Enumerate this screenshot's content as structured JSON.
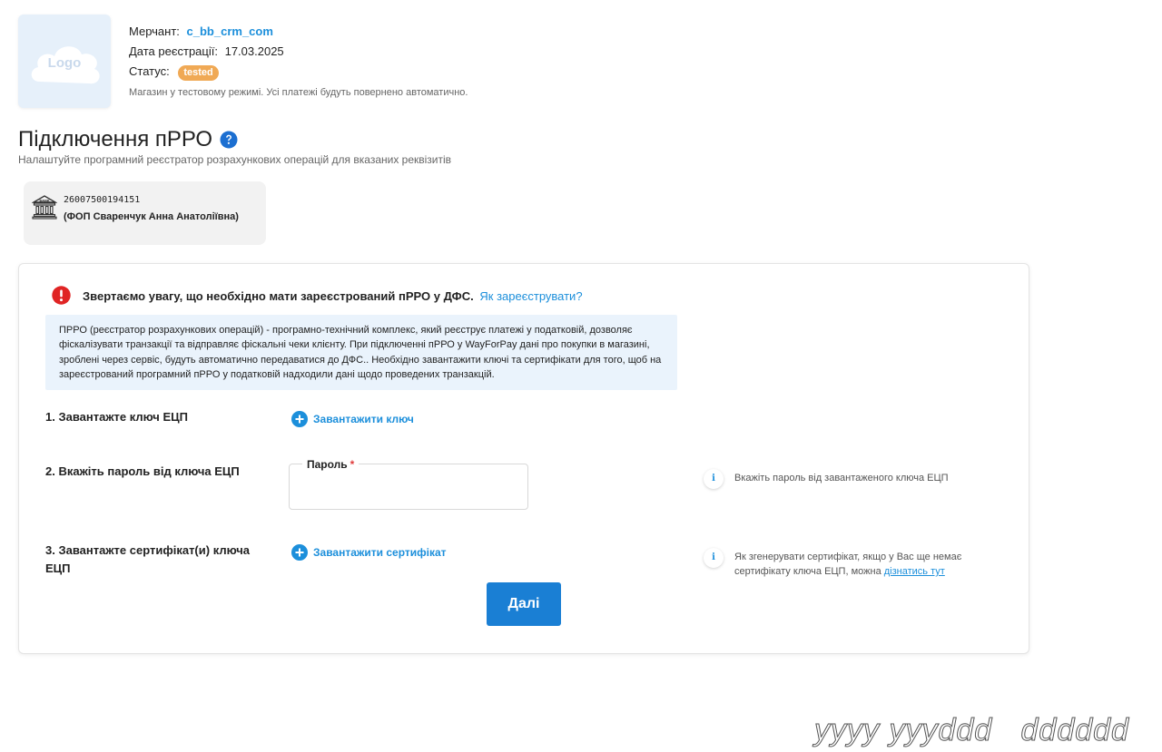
{
  "merchant": {
    "logo_text": "Logo",
    "name_label": "Мерчант:",
    "name_value": "c_bb_crm_com",
    "date_label": "Дата реєстрації:",
    "date_value": "17.03.2025",
    "status_label": "Статус:",
    "status_value": "tested",
    "note": "Магазин у тестовому режимі. Усі платежі будуть повернено автоматично."
  },
  "page": {
    "title": "Підключення пРРО",
    "subtitle": "Налаштуйте програмний реєстратор розрахункових операцій для вказаних реквізитів"
  },
  "bank": {
    "iban": "26007500194151",
    "owner": "(ФОП Сваренчук Анна Анатоліївна)"
  },
  "warning": {
    "text": "Звертаємо увагу, що необхідно мати зареєстрований пРРО у ДФС.",
    "link": "Як зареєструвати?"
  },
  "info": {
    "text": "ПРРО (реєстратор розрахункових операцій) - програмно-технічний комплекс, який реєструє платежі у податковій, дозволяє фіскалізувати транзакції та відправляє фіскальні чеки клієнту. При підключенні пРРО у WayForPay дані про покупки в магазині, зроблені через сервіс, будуть автоматично передаватися до ДФС.. Необхідно завантажити ключі та сертифікати для того, щоб на зареєстрований програмний пРРО у податковій надходили дані щодо проведених транзакцій."
  },
  "steps": {
    "step1_label": "1. Завантажте ключ ЕЦП",
    "step1_action": "Завантажити ключ",
    "step2_label": "2. Вкажіть пароль від ключа ЕЦП",
    "password_label": "Пароль",
    "password_required": "*",
    "password_value": "",
    "step2_hint": "Вкажіть пароль від завантаженого ключа ЕЦП",
    "step3_label_line1": "3. Завантажте сертифікат(и) ключа",
    "step3_label_line2": "ЕЦП",
    "step3_action": "Завантажити сертифікат",
    "step3_hint_line1": "Як згенерувати сертифікат, якщо у Вас ще немає",
    "step3_hint_line2": "сертифікату ключа ЕЦП, можна",
    "step3_hint_link": "дізнатись тут"
  },
  "buttons": {
    "next": "Далі"
  },
  "icons": {
    "help": "question-circle-icon",
    "bank": "bank-building-icon",
    "warning": "exclamation-circle-icon",
    "plus": "plus-circle-icon",
    "info": "info-icon"
  },
  "colors": {
    "accent": "#1c8fdb",
    "button": "#1a7fd4",
    "status_badge": "#f0a955",
    "warning": "#e02424",
    "info_bg": "#eaf3fc"
  },
  "watermark": "yyyy yyyddd   dddddd"
}
